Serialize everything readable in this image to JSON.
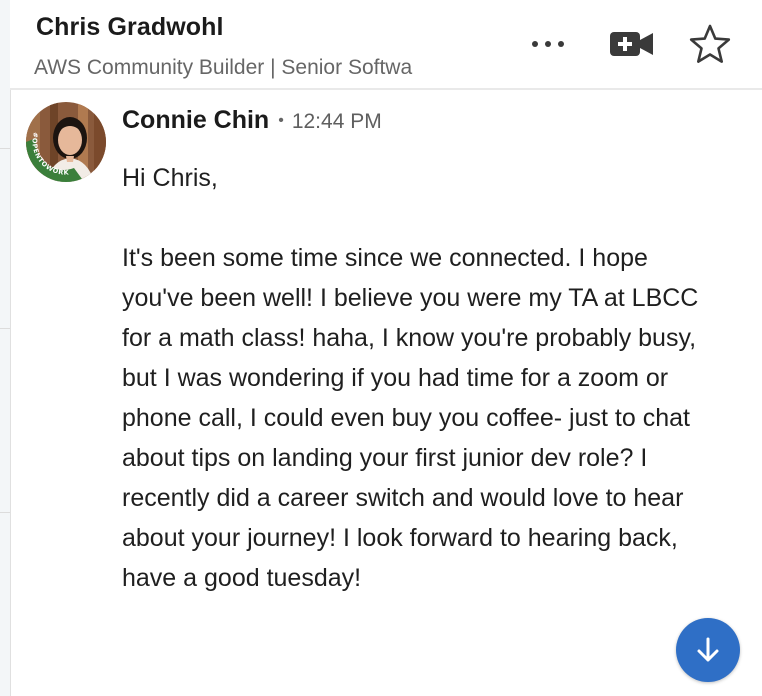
{
  "header": {
    "contact_name": "Chris Gradwohl",
    "contact_headline": "AWS Community Builder | Senior Softwa",
    "icons": {
      "more": "more-dots-icon",
      "video": "video-call-icon",
      "star": "star-icon"
    }
  },
  "message": {
    "sender_name": "Connie Chin",
    "separator": "•",
    "time": "12:44 PM",
    "avatar_badge": "#OPENTOWORK",
    "body": "Hi Chris,\n\nIt's been some time since we connected. I hope you've been well! I believe you were my TA at LBCC for a math class! haha, I know you're probably busy, but I was wondering if you had time for a zoom or phone call, I could even buy you coffee- just to chat about tips on landing your first junior dev role? I recently did a career switch and would love to hear about your journey! I look forward to hearing back, have a good tuesday!"
  },
  "scroll_button": {
    "icon": "arrow-down-icon"
  },
  "colors": {
    "accent_blue": "#2f6fc6",
    "open_to_work_green": "#3b7f3b",
    "text_primary": "#1f1f1f",
    "text_secondary": "#666666"
  }
}
